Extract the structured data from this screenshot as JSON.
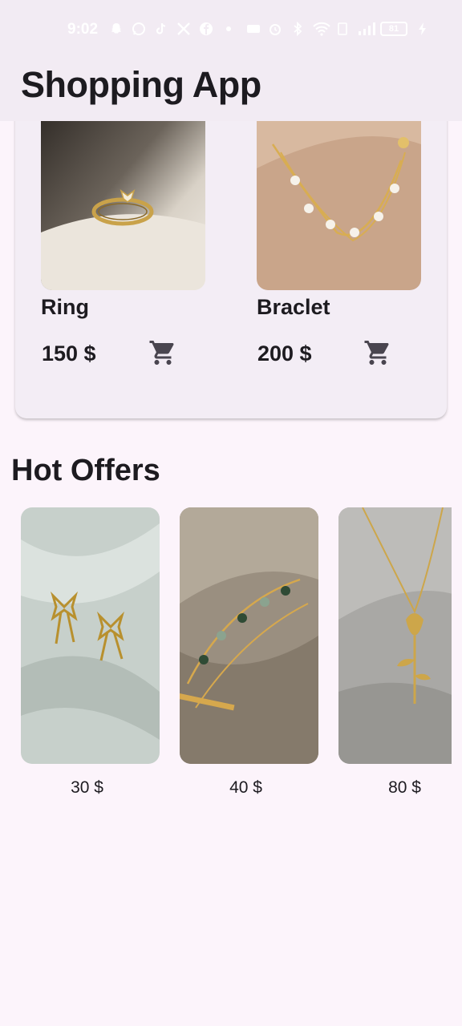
{
  "status_bar": {
    "time": "9:02",
    "left_icons": [
      "snapchat-icon",
      "whatsapp-icon",
      "tiktok-icon",
      "x-icon",
      "facebook-icon",
      "dot-icon"
    ],
    "right_icons": [
      "hotspot-icon",
      "alarm-icon",
      "bluetooth-icon",
      "wifi-icon",
      "network-type-icon",
      "signal-icon"
    ],
    "battery": "81",
    "charging_icon": "bolt-icon"
  },
  "app_bar": {
    "title": "Shopping App"
  },
  "products": [
    {
      "name": "Ring",
      "price": "150 $",
      "image": "gold-butterfly-ring",
      "cart_icon": "shopping-cart-icon"
    },
    {
      "name": "Braclet",
      "price": "200 $",
      "image": "pearl-gold-bracelet",
      "cart_icon": "shopping-cart-icon"
    }
  ],
  "hot_offers": {
    "title": "Hot Offers",
    "items": [
      {
        "price": "30 $",
        "image": "gold-bow-earrings"
      },
      {
        "price": "40 $",
        "image": "green-stone-bracelet"
      },
      {
        "price": "80 $",
        "image": "gold-rose-necklace"
      }
    ]
  },
  "colors": {
    "background": "#fcf4fb",
    "app_bar": "#f2ebf3",
    "card": "#f3edf5",
    "text": "#1d1b20",
    "icon": "#49454f"
  }
}
